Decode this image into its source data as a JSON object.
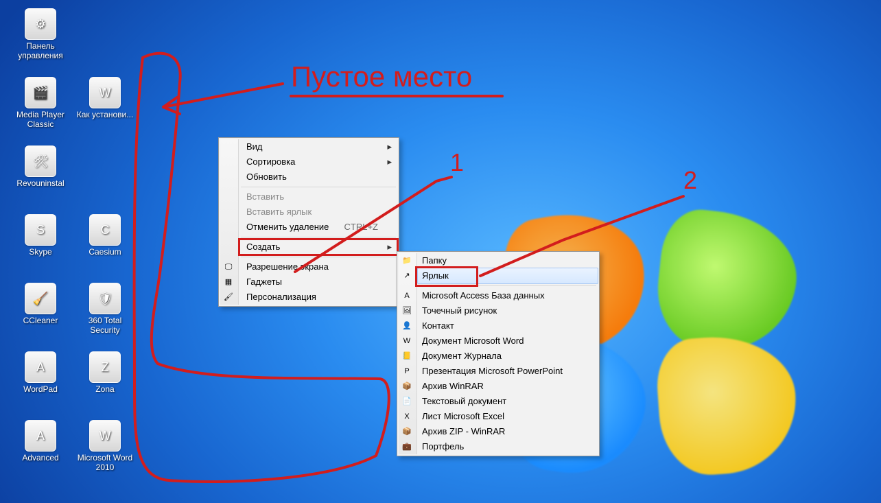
{
  "annotations": {
    "title": "Пустое место",
    "marker1": "1",
    "marker2": "2"
  },
  "desktop_icons": [
    {
      "col": 0,
      "row": 0,
      "name": "control-panel",
      "label": "Панель управления",
      "glyph": "⚙"
    },
    {
      "col": 0,
      "row": 1,
      "name": "media-player",
      "label": "Media Player Classic",
      "glyph": "🎬"
    },
    {
      "col": 0,
      "row": 2,
      "name": "revouninstal",
      "label": "Revouninstal",
      "glyph": "🛠"
    },
    {
      "col": 0,
      "row": 3,
      "name": "skype",
      "label": "Skype",
      "glyph": "S"
    },
    {
      "col": 0,
      "row": 4,
      "name": "ccleaner",
      "label": "CCleaner",
      "glyph": "🧹"
    },
    {
      "col": 0,
      "row": 5,
      "name": "wordpad",
      "label": "WordPad",
      "glyph": "A"
    },
    {
      "col": 0,
      "row": 6,
      "name": "advanced",
      "label": "Advanced",
      "glyph": "A"
    },
    {
      "col": 1,
      "row": 1,
      "name": "kak-ustanovit",
      "label": "Как установи...",
      "glyph": "W"
    },
    {
      "col": 1,
      "row": 3,
      "name": "caesium",
      "label": "Caesium",
      "glyph": "C"
    },
    {
      "col": 1,
      "row": 4,
      "name": "360-total",
      "label": "360 Total Security",
      "glyph": "🛡"
    },
    {
      "col": 1,
      "row": 5,
      "name": "zona",
      "label": "Zona",
      "glyph": "Z"
    },
    {
      "col": 1,
      "row": 6,
      "name": "word-2010",
      "label": "Microsoft Word 2010",
      "glyph": "W"
    }
  ],
  "context_menu": {
    "groups": [
      [
        {
          "id": "view",
          "label": "Вид",
          "submenu": true
        },
        {
          "id": "sort",
          "label": "Сортировка",
          "submenu": true
        },
        {
          "id": "refresh",
          "label": "Обновить"
        }
      ],
      [
        {
          "id": "paste",
          "label": "Вставить",
          "disabled": true
        },
        {
          "id": "paste-link",
          "label": "Вставить ярлык",
          "disabled": true
        },
        {
          "id": "undo-delete",
          "label": "Отменить удаление",
          "shortcut": "CTRL+Z"
        }
      ],
      [
        {
          "id": "create",
          "label": "Создать",
          "submenu": true,
          "boxed": true
        }
      ],
      [
        {
          "id": "resolution",
          "label": "Разрешение экрана",
          "icon": "🖵"
        },
        {
          "id": "gadgets",
          "label": "Гаджеты",
          "icon": "▦"
        },
        {
          "id": "personalize",
          "label": "Персонализация",
          "icon": "🖌"
        }
      ]
    ]
  },
  "create_submenu": [
    {
      "id": "folder",
      "label": "Папку",
      "icon": "📁"
    },
    {
      "id": "shortcut",
      "label": "Ярлык",
      "icon": "↗",
      "boxed": true,
      "hover": true
    },
    {
      "sep": true
    },
    {
      "id": "access-db",
      "label": "Microsoft Access База данных",
      "icon": "A"
    },
    {
      "id": "bitmap",
      "label": "Точечный рисунок",
      "icon": "🖼"
    },
    {
      "id": "contact",
      "label": "Контакт",
      "icon": "👤"
    },
    {
      "id": "word-doc",
      "label": "Документ Microsoft Word",
      "icon": "W"
    },
    {
      "id": "journal",
      "label": "Документ Журнала",
      "icon": "📒"
    },
    {
      "id": "powerpoint",
      "label": "Презентация Microsoft PowerPoint",
      "icon": "P"
    },
    {
      "id": "winrar",
      "label": "Архив WinRAR",
      "icon": "📦"
    },
    {
      "id": "text",
      "label": "Текстовый документ",
      "icon": "📄"
    },
    {
      "id": "excel",
      "label": "Лист Microsoft Excel",
      "icon": "X"
    },
    {
      "id": "zip-rar",
      "label": "Архив ZIP - WinRAR",
      "icon": "📦"
    },
    {
      "id": "briefcase",
      "label": "Портфель",
      "icon": "💼"
    }
  ]
}
